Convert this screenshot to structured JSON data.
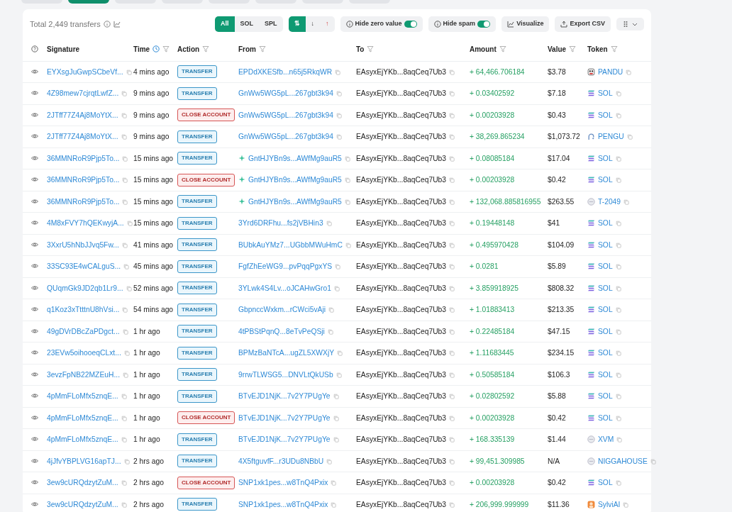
{
  "tabs": [
    {
      "selected": false
    },
    {
      "selected": true
    },
    {
      "selected": false
    },
    {
      "selected": false
    },
    {
      "selected": false
    },
    {
      "selected": false
    },
    {
      "selected": false
    },
    {
      "selected": false
    }
  ],
  "summary": {
    "total": "Total 2,449 transfers"
  },
  "filters": [
    {
      "label": "All",
      "selected": true
    },
    {
      "label": "SOL",
      "selected": false
    },
    {
      "label": "SPL",
      "selected": false
    }
  ],
  "directions": [
    {
      "label": "⇅",
      "kind": "both",
      "selected": true
    },
    {
      "label": "↓",
      "kind": "in",
      "selected": false
    },
    {
      "label": "↑",
      "kind": "out",
      "selected": false
    }
  ],
  "toggles": [
    {
      "label": "Hide zero value",
      "on": true
    },
    {
      "label": "Hide spam",
      "on": true
    }
  ],
  "actions": [
    {
      "label": "Visualize",
      "kind": "chart"
    },
    {
      "label": "Export CSV",
      "kind": "export"
    }
  ],
  "columns": [
    {
      "label": "Signature",
      "clock": false
    },
    {
      "label": "Time",
      "clock": true
    },
    {
      "label": "Action",
      "clock": false
    },
    {
      "label": "From",
      "clock": false
    },
    {
      "label": "To",
      "clock": false
    },
    {
      "label": "Amount",
      "clock": false
    },
    {
      "label": "Value",
      "clock": false
    },
    {
      "label": "Token",
      "clock": false
    }
  ],
  "rows": [
    {
      "signature": "EYXsgJuGwpSCbeVf...",
      "time": "4 mins ago",
      "action": {
        "label": "TRANSFER",
        "kind": "transfer"
      },
      "from": "EPDdXKESfb...n65j5RkqWR",
      "from_icon": false,
      "to": "EAsyxEjYKb...8aqCeq7Ub3",
      "amount": "+ 64,466.706184",
      "value": "$3.78",
      "token": {
        "label": "PANDU",
        "kind": "pandu"
      }
    },
    {
      "signature": "4Z98mew7cjrqtLwfZ...",
      "time": "9 mins ago",
      "action": {
        "label": "TRANSFER",
        "kind": "transfer"
      },
      "from": "GnWw5WG5pL...267gbt3k94",
      "from_icon": false,
      "to": "EAsyxEjYKb...8aqCeq7Ub3",
      "amount": "+ 0.03402592",
      "value": "$7.18",
      "token": {
        "label": "SOL",
        "kind": "sol"
      }
    },
    {
      "signature": "2JTff77Z4Aj8MoYtX...",
      "time": "9 mins ago",
      "action": {
        "label": "CLOSE ACCOUNT",
        "kind": "close"
      },
      "from": "GnWw5WG5pL...267gbt3k94",
      "from_icon": false,
      "to": "EAsyxEjYKb...8aqCeq7Ub3",
      "amount": "+ 0.00203928",
      "value": "$0.43",
      "token": {
        "label": "SOL",
        "kind": "sol"
      }
    },
    {
      "signature": "2JTff77Z4Aj8MoYtX...",
      "time": "9 mins ago",
      "action": {
        "label": "TRANSFER",
        "kind": "transfer"
      },
      "from": "GnWw5WG5pL...267gbt3k94",
      "from_icon": false,
      "to": "EAsyxEjYKb...8aqCeq7Ub3",
      "amount": "+ 38,269.865234",
      "value": "$1,073.72",
      "token": {
        "label": "PENGU",
        "kind": "pengu"
      }
    },
    {
      "signature": "36MMNRoR9Pjp5To...",
      "time": "15 mins ago",
      "action": {
        "label": "TRANSFER",
        "kind": "transfer"
      },
      "from": "GntHJYBn9s...AWfMg9auR5",
      "from_icon": true,
      "to": "EAsyxEjYKb...8aqCeq7Ub3",
      "amount": "+ 0.08085184",
      "value": "$17.04",
      "token": {
        "label": "SOL",
        "kind": "sol"
      }
    },
    {
      "signature": "36MMNRoR9Pjp5To...",
      "time": "15 mins ago",
      "action": {
        "label": "CLOSE ACCOUNT",
        "kind": "close"
      },
      "from": "GntHJYBn9s...AWfMg9auR5",
      "from_icon": true,
      "to": "EAsyxEjYKb...8aqCeq7Ub3",
      "amount": "+ 0.00203928",
      "value": "$0.42",
      "token": {
        "label": "SOL",
        "kind": "sol"
      }
    },
    {
      "signature": "36MMNRoR9Pjp5To...",
      "time": "15 mins ago",
      "action": {
        "label": "TRANSFER",
        "kind": "transfer"
      },
      "from": "GntHJYBn9s...AWfMg9auR5",
      "from_icon": true,
      "to": "EAsyxEjYKb...8aqCeq7Ub3",
      "amount": "+ 132,068.885816955",
      "value": "$263.55",
      "token": {
        "label": "T-2049",
        "kind": "generic"
      }
    },
    {
      "signature": "4M8xFVY7hQEKwyjA...",
      "time": "15 mins ago",
      "action": {
        "label": "TRANSFER",
        "kind": "transfer"
      },
      "from": "3Yrd6DRFhu...fs2jVBHin3",
      "from_icon": false,
      "to": "EAsyxEjYKb...8aqCeq7Ub3",
      "amount": "+ 0.19448148",
      "value": "$41",
      "token": {
        "label": "SOL",
        "kind": "sol"
      }
    },
    {
      "signature": "3XxrU5hNbJJvq5Fw...",
      "time": "41 mins ago",
      "action": {
        "label": "TRANSFER",
        "kind": "transfer"
      },
      "from": "BUbkAuYMz7...UGbbMWuHmC",
      "from_icon": false,
      "to": "EAsyxEjYKb...8aqCeq7Ub3",
      "amount": "+ 0.495970428",
      "value": "$104.09",
      "token": {
        "label": "SOL",
        "kind": "sol"
      }
    },
    {
      "signature": "33SC93E4wCALguS...",
      "time": "45 mins ago",
      "action": {
        "label": "TRANSFER",
        "kind": "transfer"
      },
      "from": "FgfZhEeWG9...pvPqqPgxYS",
      "from_icon": false,
      "to": "EAsyxEjYKb...8aqCeq7Ub3",
      "amount": "+ 0.0281",
      "value": "$5.89",
      "token": {
        "label": "SOL",
        "kind": "sol"
      }
    },
    {
      "signature": "QUqmGk9JD2qb1Lr9...",
      "time": "52 mins ago",
      "action": {
        "label": "TRANSFER",
        "kind": "transfer"
      },
      "from": "3YLwk4S4Lv...oJCAHwGro1",
      "from_icon": false,
      "to": "EAsyxEjYKb...8aqCeq7Ub3",
      "amount": "+ 3.859918925",
      "value": "$808.32",
      "token": {
        "label": "SOL",
        "kind": "sol"
      }
    },
    {
      "signature": "q1Koz3xTtttnU8hVsi...",
      "time": "54 mins ago",
      "action": {
        "label": "TRANSFER",
        "kind": "transfer"
      },
      "from": "GbpnccWxkm...rCWci5vAji",
      "from_icon": false,
      "to": "EAsyxEjYKb...8aqCeq7Ub3",
      "amount": "+ 1.01883413",
      "value": "$213.35",
      "token": {
        "label": "SOL",
        "kind": "sol"
      }
    },
    {
      "signature": "49gDVrDBcZaPDgct...",
      "time": "1 hr ago",
      "action": {
        "label": "TRANSFER",
        "kind": "transfer"
      },
      "from": "4tPBStPqnQ...8eTvPeQSji",
      "from_icon": false,
      "to": "EAsyxEjYKb...8aqCeq7Ub3",
      "amount": "+ 0.22485184",
      "value": "$47.15",
      "token": {
        "label": "SOL",
        "kind": "sol"
      }
    },
    {
      "signature": "23EVw5oihooeqCLxt...",
      "time": "1 hr ago",
      "action": {
        "label": "TRANSFER",
        "kind": "transfer"
      },
      "from": "BPMzBaNTcA...ugZL5XWXjY",
      "from_icon": false,
      "to": "EAsyxEjYKb...8aqCeq7Ub3",
      "amount": "+ 1.11683445",
      "value": "$234.15",
      "token": {
        "label": "SOL",
        "kind": "sol"
      }
    },
    {
      "signature": "3evzFpNB22MZEuH...",
      "time": "1 hr ago",
      "action": {
        "label": "TRANSFER",
        "kind": "transfer"
      },
      "from": "9rrwTLWSG5...DNVLtQkUSb",
      "from_icon": false,
      "to": "EAsyxEjYKb...8aqCeq7Ub3",
      "amount": "+ 0.50585184",
      "value": "$106.3",
      "token": {
        "label": "SOL",
        "kind": "sol"
      }
    },
    {
      "signature": "4pMmFLoMfx5znqE...",
      "time": "1 hr ago",
      "action": {
        "label": "TRANSFER",
        "kind": "transfer"
      },
      "from": "BTvEJD1NjK...7v2Y7PUgYe",
      "from_icon": false,
      "to": "EAsyxEjYKb...8aqCeq7Ub3",
      "amount": "+ 0.02802592",
      "value": "$5.88",
      "token": {
        "label": "SOL",
        "kind": "sol"
      }
    },
    {
      "signature": "4pMmFLoMfx5znqE...",
      "time": "1 hr ago",
      "action": {
        "label": "CLOSE ACCOUNT",
        "kind": "close"
      },
      "from": "BTvEJD1NjK...7v2Y7PUgYe",
      "from_icon": false,
      "to": "EAsyxEjYKb...8aqCeq7Ub3",
      "amount": "+ 0.00203928",
      "value": "$0.42",
      "token": {
        "label": "SOL",
        "kind": "sol"
      }
    },
    {
      "signature": "4pMmFLoMfx5znqE...",
      "time": "1 hr ago",
      "action": {
        "label": "TRANSFER",
        "kind": "transfer"
      },
      "from": "BTvEJD1NjK...7v2Y7PUgYe",
      "from_icon": false,
      "to": "EAsyxEjYKb...8aqCeq7Ub3",
      "amount": "+ 168.335139",
      "value": "$1.44",
      "token": {
        "label": "XVM",
        "kind": "generic"
      }
    },
    {
      "signature": "4jJfvYBPLVG16apTJ...",
      "time": "2 hrs ago",
      "action": {
        "label": "TRANSFER",
        "kind": "transfer"
      },
      "from": "4X5ftguvfF...r3UDu8NBbU",
      "from_icon": false,
      "to": "EAsyxEjYKb...8aqCeq7Ub3",
      "amount": "+ 99,451.309985",
      "value": "N/A",
      "token": {
        "label": "NIGGAHOUSE",
        "kind": "generic"
      }
    },
    {
      "signature": "3ew9cURQdzytZuM...",
      "time": "2 hrs ago",
      "action": {
        "label": "CLOSE ACCOUNT",
        "kind": "close"
      },
      "from": "SNP1xk1pes...w8TnQ4Pxix",
      "from_icon": false,
      "to": "EAsyxEjYKb...8aqCeq7Ub3",
      "amount": "+ 0.00203928",
      "value": "$0.42",
      "token": {
        "label": "SOL",
        "kind": "sol"
      }
    },
    {
      "signature": "3ew9cURQdzytZuM...",
      "time": "2 hrs ago",
      "action": {
        "label": "TRANSFER",
        "kind": "transfer"
      },
      "from": "SNP1xk1pes...w8TnQ4Pxix",
      "from_icon": false,
      "to": "EAsyxEjYKb...8aqCeq7Ub3",
      "amount": "+ 206,999.999999",
      "value": "$11.36",
      "token": {
        "label": "SylviAI",
        "kind": "sylvi"
      }
    }
  ]
}
